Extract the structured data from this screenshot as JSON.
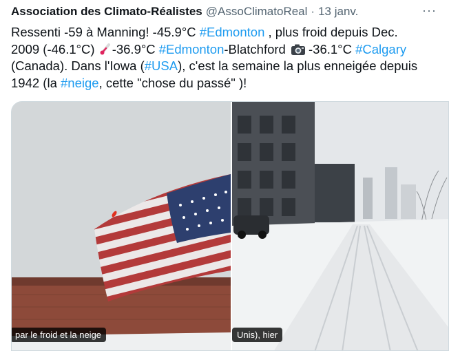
{
  "tweet": {
    "author_name": "Association des Climato-Réalistes",
    "author_handle": "@AssoClimatoReal",
    "separator": "·",
    "timestamp": "13 janv.",
    "more_label": "···",
    "text": {
      "l1_a": "Ressenti -59 à Manning!  -45.9°C ",
      "l1_link": "#Edmonton",
      "l1_b": " , plus froid depuis Dec.",
      "l2_a": "2009 (-46.1°C) ",
      "l2_b": "-36.9°C ",
      "l2_link1": "#Edmonton",
      "l2_c": "-Blatchford ",
      "l2_d": "-36.1°C ",
      "l2_link2": "#Calgary",
      "l3_a": "(Canada). Dans l'Iowa (",
      "l3_link": "#USA",
      "l3_b": "), c'est la semaine la plus enneigée depuis",
      "l4_a": "1942 (la ",
      "l4_link": "#neige",
      "l4_b": ", cette \"chose du passé\" )!"
    },
    "media": {
      "left_caption": "par le froid et la neige",
      "right_caption": "Unis), hier"
    }
  }
}
